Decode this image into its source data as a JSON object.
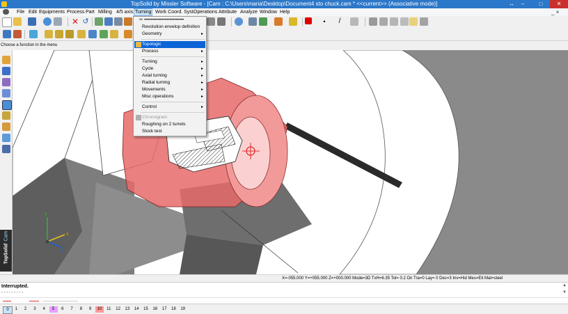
{
  "window": {
    "title": "TopSolid by Missler Software - [Cam : C:\\Users\\maria\\Desktop\\Document4 sto chuck.cam * <<current>> (Associative mode)]",
    "minimize": "–",
    "maximize": "□",
    "close": "✕",
    "restore_glyph": "↔"
  },
  "menubar": {
    "items": [
      "File",
      "Edit",
      "Equipments",
      "Process",
      "Part",
      "Milling",
      "4/5 axis",
      "Turning",
      "Work Coord. Syst.",
      "Operations",
      "Attribute",
      "Analyze",
      "Window",
      "Help"
    ],
    "active": "Turning",
    "mdi_controls": "_ ×"
  },
  "prompt": "Choose a function in the menu",
  "turning_menu": {
    "tear_off": "✂ •••••••••••••••••••••••••",
    "items": [
      {
        "label": "Revolution envelop definition",
        "submenu": false
      },
      {
        "label": "Geometry",
        "submenu": true
      },
      {
        "label": "Topologic",
        "submenu": false,
        "highlighted": true
      },
      {
        "label": "Process",
        "submenu": true
      },
      {
        "label": "Turning",
        "submenu": true
      },
      {
        "label": "Cycle",
        "submenu": true
      },
      {
        "label": "Axial turning",
        "submenu": true
      },
      {
        "label": "Radial turning",
        "submenu": true
      },
      {
        "label": "Movements",
        "submenu": true
      },
      {
        "label": "Misc operations",
        "submenu": true
      },
      {
        "label": "Control",
        "submenu": true
      },
      {
        "label": "Chronogram",
        "submenu": false,
        "disabled": true
      },
      {
        "label": "Roughing on 2 turrets",
        "submenu": false
      },
      {
        "label": "Stock test",
        "submenu": false
      }
    ],
    "arrow": "▸"
  },
  "brand": {
    "name": "TopSolid",
    "suffix": "' Cam"
  },
  "statusbar": "X=-055.000   Y=+055.000   Z=+000.000   Mode=3D   TxH=6.35    Tol=  0.2    On  Tra=0    Lay=  0    Dec=3    Inv=Hid   Mes=Elt   Mat=steel",
  "message": {
    "text": "Interrupted.",
    "sub": "- - - - - - - - -"
  },
  "layers": {
    "items": [
      "0",
      "1",
      "2",
      "3",
      "4",
      "5",
      "6",
      "7",
      "8",
      "9",
      "10",
      "11",
      "12",
      "13",
      "14",
      "15",
      "16",
      "17",
      "18",
      "19"
    ],
    "selected": "0",
    "current": "5",
    "marked": "10"
  },
  "colors": {
    "accent": "#2b77c9",
    "highlight": "#0a64d6",
    "part_red": "#e86a6a",
    "part_pink": "#f7bcbc"
  }
}
